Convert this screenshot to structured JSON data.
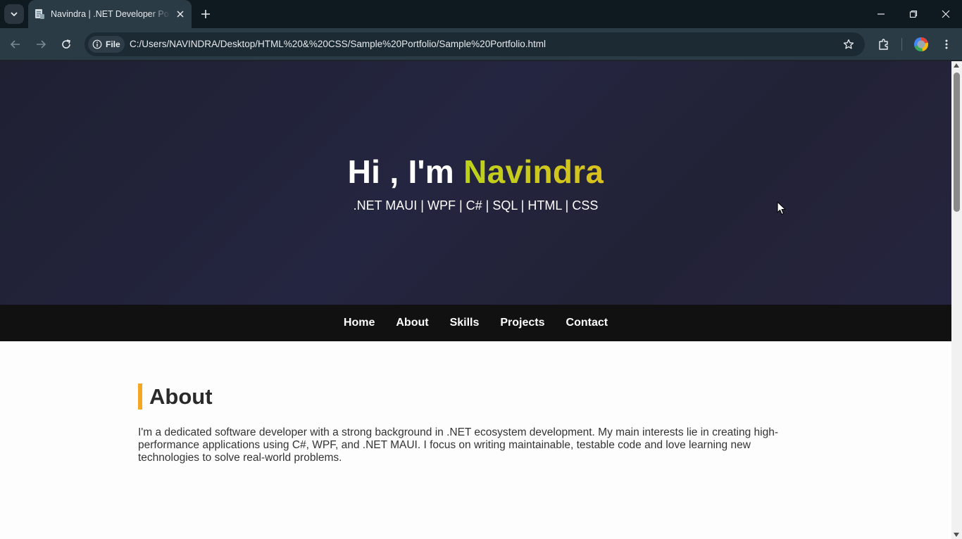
{
  "browser": {
    "tab": {
      "title": "Navindra | .NET Developer Portfolio"
    },
    "toolbar": {
      "site_chip": "File",
      "url": "C:/Users/NAVINDRA/Desktop/HTML%20&%20CSS/Sample%20Portfolio/Sample%20Portfolio.html"
    },
    "icons": {
      "tab_search": "chevron-down-icon",
      "favicon": "document-icon",
      "tab_close": "close-icon",
      "new_tab": "plus-icon",
      "back": "arrow-left-icon",
      "forward": "arrow-right-icon",
      "reload": "reload-icon",
      "info": "info-icon",
      "bookmark": "star-icon",
      "extensions": "puzzle-icon",
      "profile": "profile-avatar-icon",
      "menu": "kebab-menu-icon",
      "minimize": "minimize-icon",
      "restore": "restore-icon",
      "close_window": "close-icon"
    }
  },
  "page": {
    "hero": {
      "greeting": "Hi , I'm ",
      "name": "Navindra",
      "tagline": ".NET MAUI | WPF | C# | SQL | HTML | CSS"
    },
    "nav": {
      "items": [
        {
          "label": "Home"
        },
        {
          "label": "About"
        },
        {
          "label": "Skills"
        },
        {
          "label": "Projects"
        },
        {
          "label": "Contact"
        }
      ]
    },
    "about": {
      "heading": "About",
      "body": "I'm a dedicated software developer with a strong background in .NET ecosystem development. My main interests lie in creating high-performance applications using C#, WPF, and .NET MAUI. I focus on writing maintainable, testable code and love learning new technologies to solve real-world problems."
    }
  },
  "colors": {
    "hero_bg": "#222236",
    "accent_name": "#c8d11b",
    "nav_bg": "#111111",
    "heading_bar": "#f5a623"
  }
}
